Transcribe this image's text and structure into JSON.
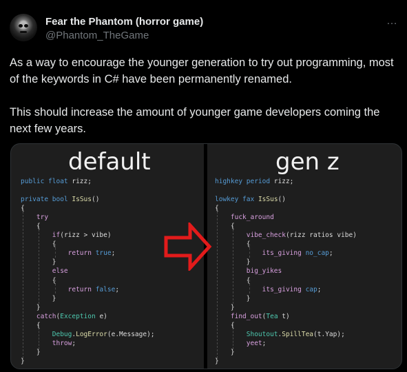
{
  "tweet": {
    "author_name": "Fear the Phantom (horror game)",
    "handle": "@Phantom_TheGame",
    "more_icon": "…",
    "paragraphs": [
      "As a way to encourage the younger generation to try out programming, most of the keywords in C# have been permanently renamed.",
      "This should increase the amount of younger game developers coming the next few years."
    ]
  },
  "image": {
    "left_title": "default",
    "right_title": "gen z",
    "arrow_color": "#e21b1b",
    "left_code": [
      [
        {
          "t": "public float",
          "c": "kw"
        },
        {
          "t": " rizz;",
          "c": "pl"
        }
      ],
      [],
      [
        {
          "t": "private bool",
          "c": "kw"
        },
        {
          "t": " ",
          "c": "pl"
        },
        {
          "t": "IsSus",
          "c": "fn"
        },
        {
          "t": "()",
          "c": "pl"
        }
      ],
      [
        {
          "t": "{",
          "c": "pl"
        }
      ],
      [
        {
          "t": "    ",
          "c": "pl"
        },
        {
          "t": "try",
          "c": "ctl"
        }
      ],
      [
        {
          "t": "    {",
          "c": "pl"
        }
      ],
      [
        {
          "t": "        ",
          "c": "pl"
        },
        {
          "t": "if",
          "c": "ctl"
        },
        {
          "t": "(rizz > vibe)",
          "c": "pl"
        }
      ],
      [
        {
          "t": "        {",
          "c": "pl"
        }
      ],
      [
        {
          "t": "            ",
          "c": "pl"
        },
        {
          "t": "return",
          "c": "ctl"
        },
        {
          "t": " ",
          "c": "pl"
        },
        {
          "t": "true",
          "c": "kw"
        },
        {
          "t": ";",
          "c": "pl"
        }
      ],
      [
        {
          "t": "        }",
          "c": "pl"
        }
      ],
      [
        {
          "t": "        ",
          "c": "pl"
        },
        {
          "t": "else",
          "c": "ctl"
        }
      ],
      [
        {
          "t": "        {",
          "c": "pl"
        }
      ],
      [
        {
          "t": "            ",
          "c": "pl"
        },
        {
          "t": "return",
          "c": "ctl"
        },
        {
          "t": " ",
          "c": "pl"
        },
        {
          "t": "false",
          "c": "kw"
        },
        {
          "t": ";",
          "c": "pl"
        }
      ],
      [
        {
          "t": "        }",
          "c": "pl"
        }
      ],
      [
        {
          "t": "    }",
          "c": "pl"
        }
      ],
      [
        {
          "t": "    ",
          "c": "pl"
        },
        {
          "t": "catch",
          "c": "ctl"
        },
        {
          "t": "(",
          "c": "pl"
        },
        {
          "t": "Exception",
          "c": "ty"
        },
        {
          "t": " e)",
          "c": "pl"
        }
      ],
      [
        {
          "t": "    {",
          "c": "pl"
        }
      ],
      [
        {
          "t": "        ",
          "c": "pl"
        },
        {
          "t": "Debug",
          "c": "ty"
        },
        {
          "t": ".",
          "c": "pl"
        },
        {
          "t": "LogError",
          "c": "fn"
        },
        {
          "t": "(e.Message);",
          "c": "pl"
        }
      ],
      [
        {
          "t": "        ",
          "c": "pl"
        },
        {
          "t": "throw",
          "c": "ctl"
        },
        {
          "t": ";",
          "c": "pl"
        }
      ],
      [
        {
          "t": "    }",
          "c": "pl"
        }
      ],
      [
        {
          "t": "}",
          "c": "pl"
        }
      ]
    ],
    "right_code": [
      [
        {
          "t": "highkey period",
          "c": "kw"
        },
        {
          "t": " rizz;",
          "c": "pl"
        }
      ],
      [],
      [
        {
          "t": "lowkey fax",
          "c": "kw"
        },
        {
          "t": " ",
          "c": "pl"
        },
        {
          "t": "IsSus",
          "c": "fn"
        },
        {
          "t": "()",
          "c": "pl"
        }
      ],
      [
        {
          "t": "{",
          "c": "pl"
        }
      ],
      [
        {
          "t": "    ",
          "c": "pl"
        },
        {
          "t": "fuck_around",
          "c": "ctl"
        }
      ],
      [
        {
          "t": "    {",
          "c": "pl"
        }
      ],
      [
        {
          "t": "        ",
          "c": "pl"
        },
        {
          "t": "vibe_check",
          "c": "ctl"
        },
        {
          "t": "(rizz ratios vibe)",
          "c": "pl"
        }
      ],
      [
        {
          "t": "        {",
          "c": "pl"
        }
      ],
      [
        {
          "t": "            ",
          "c": "pl"
        },
        {
          "t": "its_giving",
          "c": "ctl"
        },
        {
          "t": " ",
          "c": "pl"
        },
        {
          "t": "no_cap",
          "c": "kw"
        },
        {
          "t": ";",
          "c": "pl"
        }
      ],
      [
        {
          "t": "        }",
          "c": "pl"
        }
      ],
      [
        {
          "t": "        ",
          "c": "pl"
        },
        {
          "t": "big_yikes",
          "c": "ctl"
        }
      ],
      [
        {
          "t": "        {",
          "c": "pl"
        }
      ],
      [
        {
          "t": "            ",
          "c": "pl"
        },
        {
          "t": "its_giving",
          "c": "ctl"
        },
        {
          "t": " ",
          "c": "pl"
        },
        {
          "t": "cap",
          "c": "kw"
        },
        {
          "t": ";",
          "c": "pl"
        }
      ],
      [
        {
          "t": "        }",
          "c": "pl"
        }
      ],
      [
        {
          "t": "    }",
          "c": "pl"
        }
      ],
      [
        {
          "t": "    ",
          "c": "pl"
        },
        {
          "t": "find_out",
          "c": "ctl"
        },
        {
          "t": "(",
          "c": "pl"
        },
        {
          "t": "Tea",
          "c": "ty"
        },
        {
          "t": " t)",
          "c": "pl"
        }
      ],
      [
        {
          "t": "    {",
          "c": "pl"
        }
      ],
      [
        {
          "t": "        ",
          "c": "pl"
        },
        {
          "t": "Shoutout",
          "c": "ty"
        },
        {
          "t": ".",
          "c": "pl"
        },
        {
          "t": "SpillTea",
          "c": "fn"
        },
        {
          "t": "(t.Yap);",
          "c": "pl"
        }
      ],
      [
        {
          "t": "        ",
          "c": "pl"
        },
        {
          "t": "yeet",
          "c": "ctl"
        },
        {
          "t": ";",
          "c": "pl"
        }
      ],
      [
        {
          "t": "    }",
          "c": "pl"
        }
      ],
      [
        {
          "t": "}",
          "c": "pl"
        }
      ]
    ]
  }
}
